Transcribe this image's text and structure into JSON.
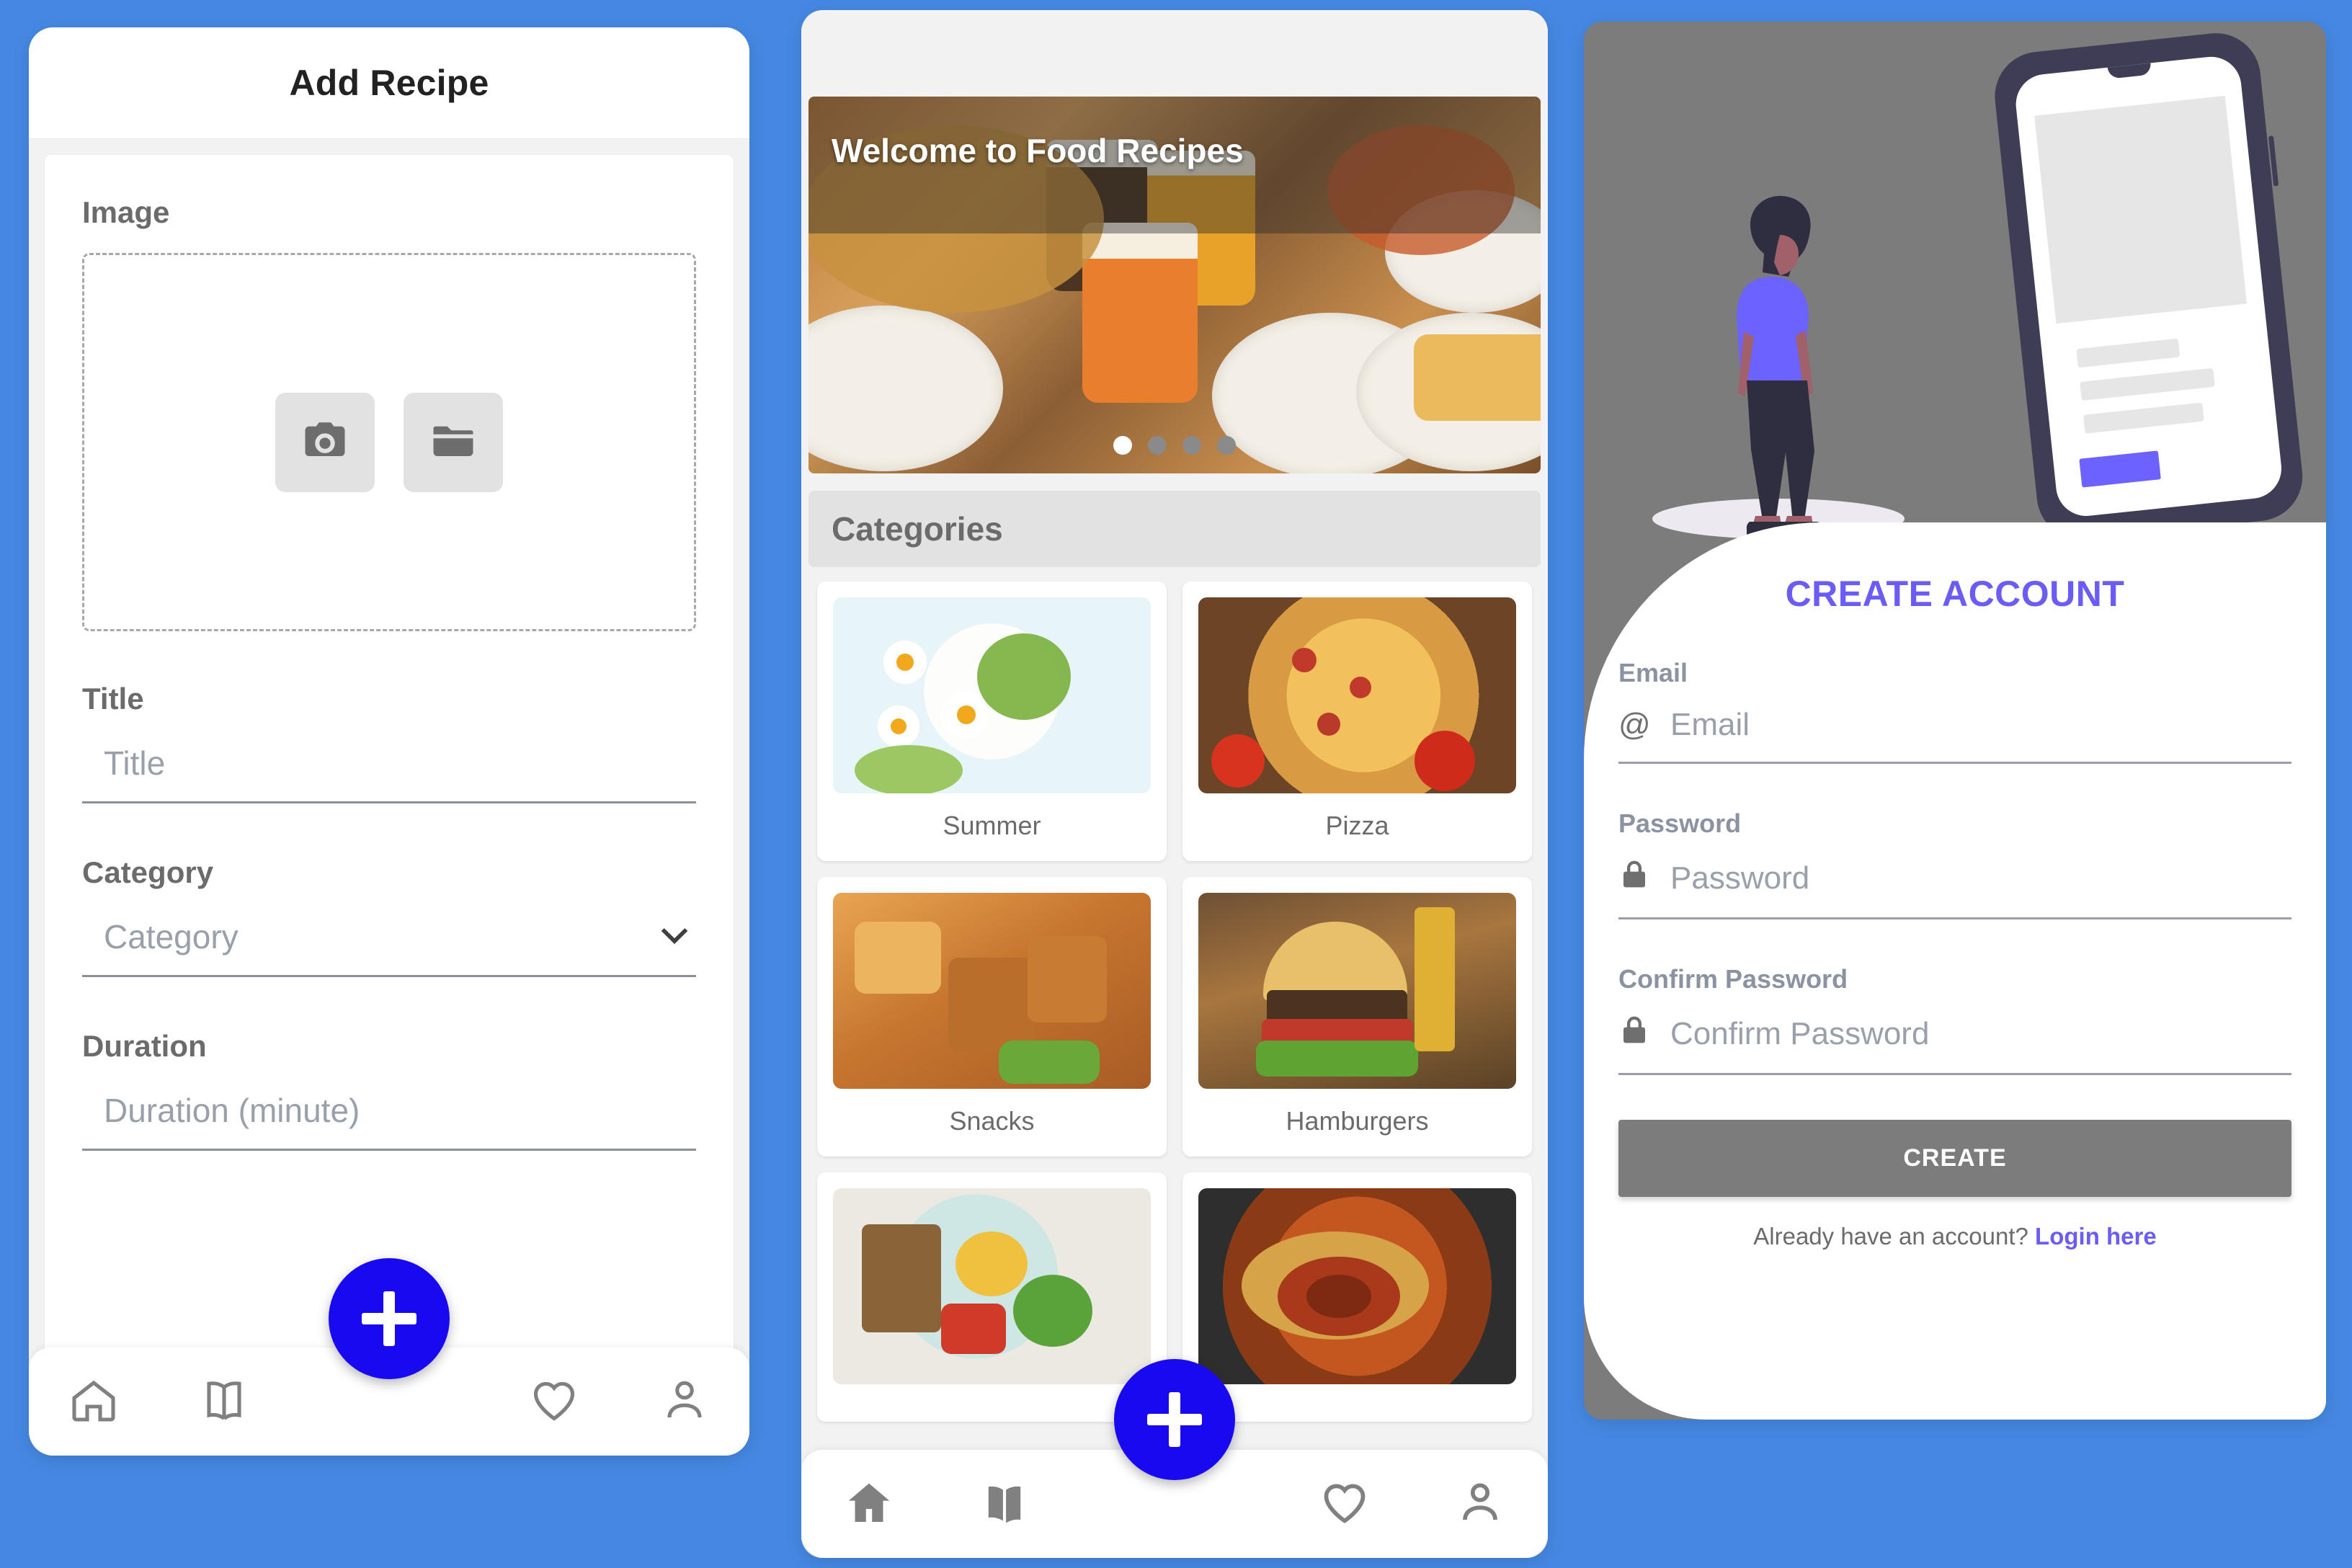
{
  "background_color": "#4588e3",
  "accent_blue": "#1909f0",
  "accent_purple": "#6a5cf5",
  "add_recipe": {
    "app_bar_title": "Add Recipe",
    "image_label": "Image",
    "image_camera_icon": "camera-icon",
    "image_folder_icon": "folder-icon",
    "title_label": "Title",
    "title_placeholder": "Title",
    "category_label": "Category",
    "category_placeholder": "Category",
    "category_chevron_icon": "chevron-down-icon",
    "duration_label": "Duration",
    "duration_placeholder": "Duration (minute)",
    "nav": [
      {
        "icon": "home-icon",
        "label": "Home"
      },
      {
        "icon": "book-icon",
        "label": "Recipes"
      },
      {
        "icon": "heart-icon",
        "label": "Favorites"
      },
      {
        "icon": "person-icon",
        "label": "Profile"
      }
    ],
    "fab_icon": "plus-icon"
  },
  "home": {
    "banner_title": "Welcome to Food Recipes",
    "carousel": {
      "count": 4,
      "active_index": 0
    },
    "categories_header": "Categories",
    "categories": [
      {
        "name": "Summer",
        "art": "ph-summer"
      },
      {
        "name": "Pizza",
        "art": "ph-pizza"
      },
      {
        "name": "Snacks",
        "art": "ph-snacks"
      },
      {
        "name": "Hamburgers",
        "art": "ph-burger"
      },
      {
        "name": "",
        "art": "ph-breakfast"
      },
      {
        "name": "",
        "art": "ph-pasta"
      }
    ],
    "nav": [
      {
        "icon": "home-icon",
        "label": "Home"
      },
      {
        "icon": "book-icon",
        "label": "Recipes"
      },
      {
        "icon": "heart-icon",
        "label": "Favorites"
      },
      {
        "icon": "person-icon",
        "label": "Profile"
      }
    ],
    "fab_icon": "plus-icon"
  },
  "create_account": {
    "heading": "CREATE ACCOUNT",
    "email_label": "Email",
    "email_placeholder": "Email",
    "email_icon": "at-sign-icon",
    "password_label": "Password",
    "password_placeholder": "Password",
    "password_icon": "lock-icon",
    "confirm_label": "Confirm Password",
    "confirm_placeholder": "Confirm Password",
    "confirm_icon": "lock-icon",
    "submit_label": "CREATE",
    "footer_text": "Already have an account?",
    "footer_link": "Login here"
  }
}
